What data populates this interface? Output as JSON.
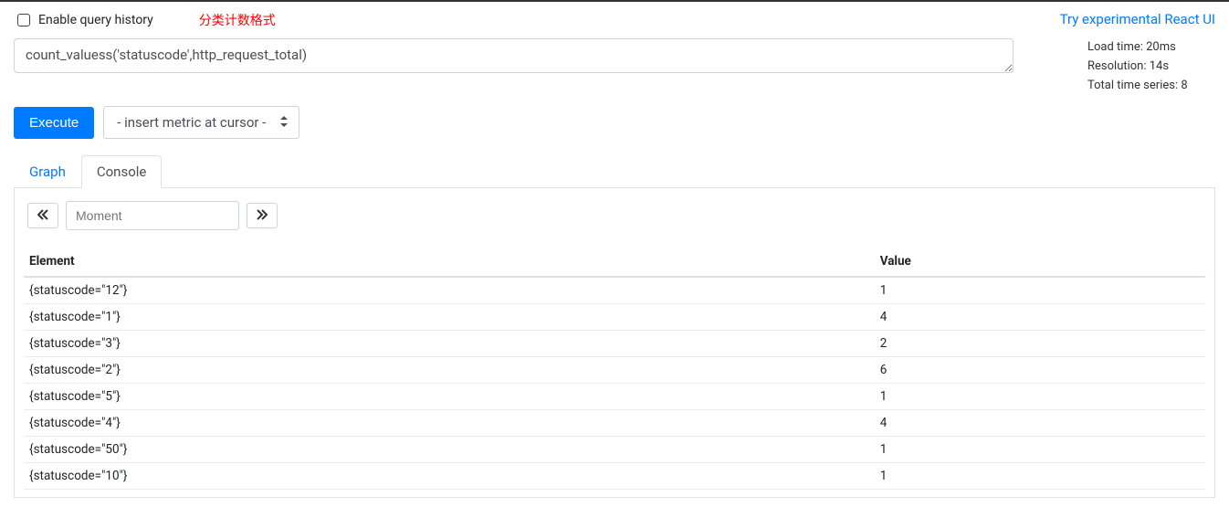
{
  "header": {
    "enable_history_label": "Enable query history",
    "annotation": "分类计数格式",
    "react_link": "Try experimental React UI"
  },
  "query": {
    "expression": "count_valuess('statuscode',http_request_total)"
  },
  "stats": {
    "load_time": "Load time: 20ms",
    "resolution": "Resolution: 14s",
    "total_series": "Total time series: 8"
  },
  "controls": {
    "execute_label": "Execute",
    "metric_placeholder": "- insert metric at cursor -"
  },
  "tabs": {
    "graph": "Graph",
    "console": "Console"
  },
  "moment": {
    "placeholder": "Moment"
  },
  "table": {
    "headers": {
      "element": "Element",
      "value": "Value"
    },
    "rows": [
      {
        "element": "{statuscode=\"12\"}",
        "value": "1"
      },
      {
        "element": "{statuscode=\"1\"}",
        "value": "4"
      },
      {
        "element": "{statuscode=\"3\"}",
        "value": "2"
      },
      {
        "element": "{statuscode=\"2\"}",
        "value": "6"
      },
      {
        "element": "{statuscode=\"5\"}",
        "value": "1"
      },
      {
        "element": "{statuscode=\"4\"}",
        "value": "4"
      },
      {
        "element": "{statuscode=\"50\"}",
        "value": "1"
      },
      {
        "element": "{statuscode=\"10\"}",
        "value": "1"
      }
    ]
  }
}
